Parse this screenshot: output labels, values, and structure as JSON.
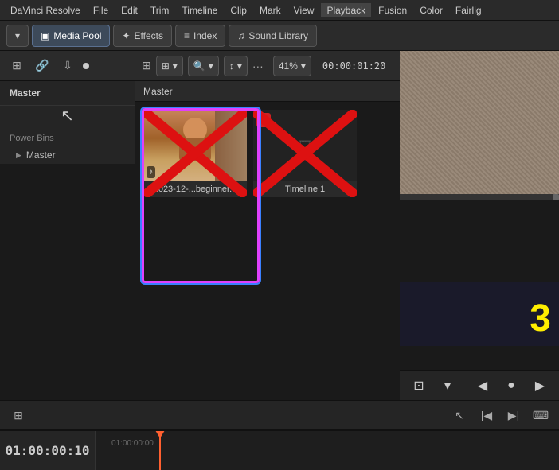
{
  "menu": {
    "items": [
      "DaVinci Resolve",
      "File",
      "Edit",
      "Trim",
      "Timeline",
      "Clip",
      "Mark",
      "View",
      "Playback",
      "Fusion",
      "Color",
      "Fairlig"
    ]
  },
  "toolbar": {
    "media_pool": "Media Pool",
    "effects": "Effects",
    "index": "Index",
    "sound_library": "Sound Library",
    "zoom": "41%",
    "timecode": "00:00:01:20"
  },
  "sidebar": {
    "header": "Master",
    "section": "Power Bins",
    "master_item": "Master"
  },
  "content": {
    "header": "Master",
    "clips": [
      {
        "id": "clip1",
        "label": "2023-12-...beginner...",
        "has_music": true,
        "type": "video"
      },
      {
        "id": "clip2",
        "label": "Timeline 1",
        "has_music": false,
        "type": "timeline"
      }
    ]
  },
  "timeline": {
    "time_left": "01:00:00:10",
    "time_ruler": "01:00:00:00"
  },
  "icons": {
    "chevron_right": "▶",
    "music_note": "♪",
    "film": "🎞",
    "check": "✓",
    "arrow_left": "◀",
    "arrow_right": "▶",
    "grid": "⊞",
    "search": "🔍",
    "sort": "↕",
    "more": "···",
    "cursor": "↖",
    "select": "↖",
    "trim_start": "|◀",
    "trim_end": "▶|",
    "keyboard": "⌨"
  },
  "right_panel": {
    "yellow_number": "3"
  }
}
